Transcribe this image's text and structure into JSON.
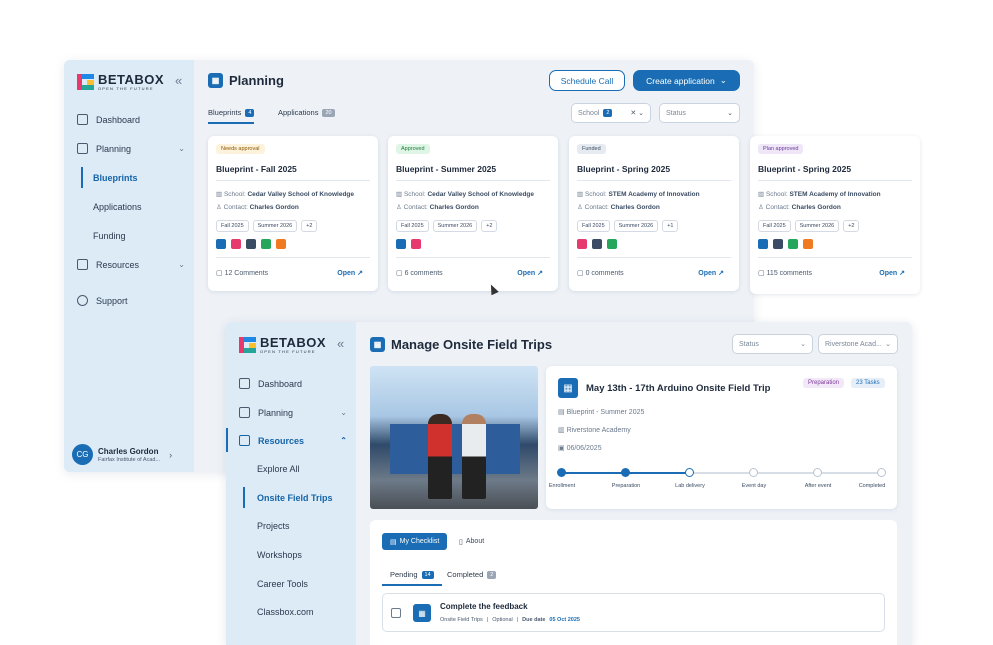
{
  "planning": {
    "logo": {
      "brand": "BETABOX",
      "tagline": "OPEN THE FUTURE"
    },
    "nav": [
      {
        "label": "Dashboard",
        "icon": "grid-icon"
      },
      {
        "label": "Planning",
        "icon": "map-icon"
      },
      {
        "label": "Resources",
        "icon": "briefcase-icon"
      },
      {
        "label": "Support",
        "icon": "chat-icon"
      }
    ],
    "subnav": [
      "Blueprints",
      "Applications",
      "Funding"
    ],
    "user": {
      "initials": "CG",
      "name": "Charles Gordon",
      "org": "Fairfax Institute of Acad..."
    },
    "title": "Planning",
    "schedule_label": "Schedule Call",
    "create_label": "Create application",
    "tabs": [
      {
        "label": "Blueprints",
        "count": "4"
      },
      {
        "label": "Applications",
        "count": "20"
      }
    ],
    "filters": {
      "school": "School",
      "school_count": "2",
      "status": "Status"
    },
    "cards": [
      {
        "badge": "Needs approval",
        "title": "Blueprint - Fall 2025",
        "school_label": "School:",
        "school": "Cedar Valley School of Knowledge",
        "contact_label": "Contact:",
        "contact": "Charles Gordon",
        "pills": [
          "Fall 2025",
          "Summer 2026",
          "+2"
        ],
        "comments": "12 Comments",
        "open": "Open"
      },
      {
        "badge": "Approved",
        "title": "Blueprint - Summer 2025",
        "school_label": "School:",
        "school": "Cedar Valley School of Knowledge",
        "contact_label": "Contact:",
        "contact": "Charles Gordon",
        "pills": [
          "Fall 2025",
          "Summer 2026",
          "+2"
        ],
        "comments": "6 comments",
        "open": "Open"
      },
      {
        "badge": "Funded",
        "title": "Blueprint - Spring 2025",
        "school_label": "School:",
        "school": "STEM Academy of Innovation",
        "contact_label": "Contact:",
        "contact": "Charles Gordon",
        "pills": [
          "Fall 2025",
          "Summer 2026",
          "+1"
        ],
        "comments": "0 comments",
        "open": "Open"
      },
      {
        "badge": "Plan approved",
        "title": "Blueprint - Spring 2025",
        "school_label": "School:",
        "school": "STEM Academy of Innovation",
        "contact_label": "Contact:",
        "contact": "Charles Gordon",
        "pills": [
          "Fall 2025",
          "Summer 2026",
          "+2"
        ],
        "comments": "115 comments",
        "open": "Open"
      }
    ]
  },
  "trips": {
    "logo": {
      "brand": "BETABOX",
      "tagline": "OPEN THE FUTURE"
    },
    "nav": [
      {
        "label": "Dashboard",
        "icon": "grid-icon"
      },
      {
        "label": "Planning",
        "icon": "map-icon"
      },
      {
        "label": "Resources",
        "icon": "briefcase-icon"
      }
    ],
    "subnav": [
      "Explore All",
      "Onsite Field Trips",
      "Projects",
      "Workshops",
      "Career Tools",
      "Classbox.com"
    ],
    "title": "Manage Onsite Field Trips",
    "filters": {
      "status": "Status",
      "school": "Riverstone Acad..."
    },
    "trip": {
      "title": "May 13th - 17th Arduino Onsite Field Trip",
      "badge": "Preparation",
      "tasks": "23 Tasks",
      "blueprint": "Blueprint - Summer 2025",
      "school": "Riverstone Academy",
      "date": "06/06/2025",
      "steps": [
        "Enrollment",
        "Preparation",
        "Lab delivery",
        "Event day",
        "After event",
        "Completed"
      ]
    },
    "tabs": {
      "checklist": "My Checklist",
      "about": "About"
    },
    "subtabs": [
      {
        "label": "Pending",
        "count": "14"
      },
      {
        "label": "Completed",
        "count": "2"
      }
    ],
    "task": {
      "title": "Complete the feedback",
      "category": "Onsite Field Trips",
      "optional": "Optional",
      "due_label": "Due date",
      "due": "05 Oct 2025"
    }
  }
}
